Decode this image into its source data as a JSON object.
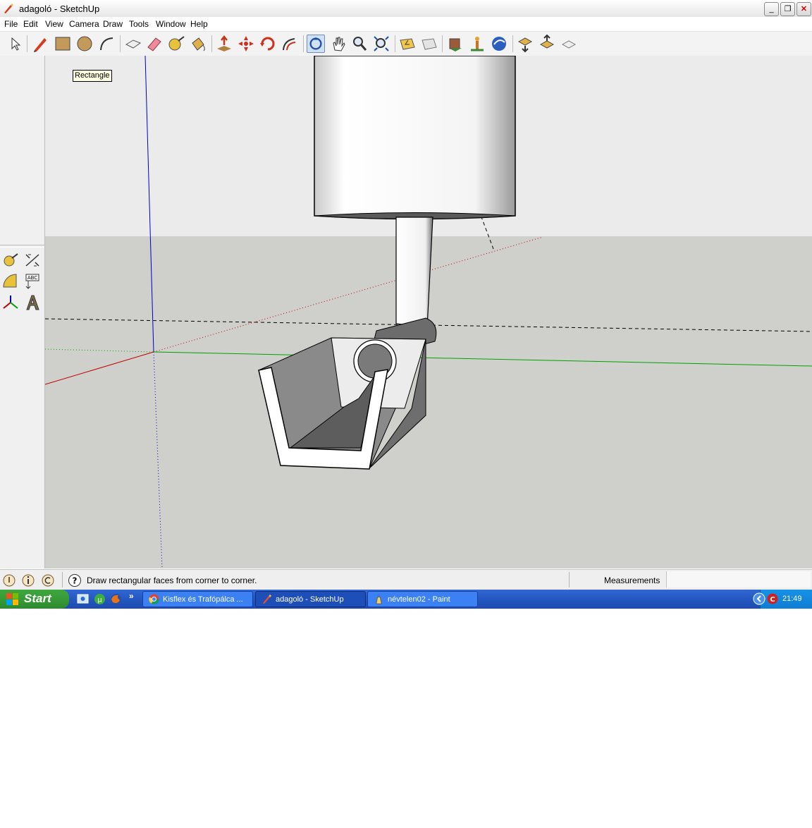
{
  "window": {
    "title": "adagoló - SketchUp"
  },
  "menu": [
    "File",
    "Edit",
    "View",
    "Camera",
    "Draw",
    "Tools",
    "Window",
    "Help"
  ],
  "toolbar": {
    "tools": [
      {
        "name": "select-tool-icon"
      },
      {
        "name": "pencil-tool-icon"
      },
      {
        "name": "rectangle-tool-icon"
      },
      {
        "name": "circle-tool-icon"
      },
      {
        "name": "arc-tool-icon"
      },
      {
        "name": "make-component-icon"
      },
      {
        "name": "eraser-tool-icon"
      },
      {
        "name": "tape-measure-icon"
      },
      {
        "name": "paint-bucket-icon"
      },
      {
        "name": "push-pull-icon"
      },
      {
        "name": "move-tool-icon"
      },
      {
        "name": "rotate-tool-icon"
      },
      {
        "name": "offset-tool-icon"
      },
      {
        "name": "orbit-tool-icon"
      },
      {
        "name": "pan-tool-icon"
      },
      {
        "name": "zoom-tool-icon"
      },
      {
        "name": "zoom-extents-icon"
      },
      {
        "name": "previous-view-icon"
      },
      {
        "name": "next-view-icon"
      },
      {
        "name": "get-models-icon"
      },
      {
        "name": "place-model-icon"
      },
      {
        "name": "google-earth-icon"
      },
      {
        "name": "get-models-2-icon"
      },
      {
        "name": "share-model-icon"
      },
      {
        "name": "share-component-icon"
      }
    ],
    "active_tool": "orbit-tool-icon"
  },
  "viewport": {
    "tooltip": "Rectangle"
  },
  "status": {
    "hint": "Draw rectangular faces from corner to corner.",
    "measurements_label": "Measurements",
    "measurements_value": ""
  },
  "taskbar": {
    "start_label": "Start",
    "tasks": [
      {
        "label": "Kisflex és Trafópálca ..."
      },
      {
        "label": "adagoló - SketchUp"
      },
      {
        "label": "névtelen02 - Paint"
      }
    ],
    "clock": "21:49"
  },
  "colors": {
    "sky": "#e9e9e9",
    "ground": "#cfcfcb",
    "red_axis": "#c00000",
    "green_axis": "#00a000",
    "blue_axis": "#0000c8"
  }
}
